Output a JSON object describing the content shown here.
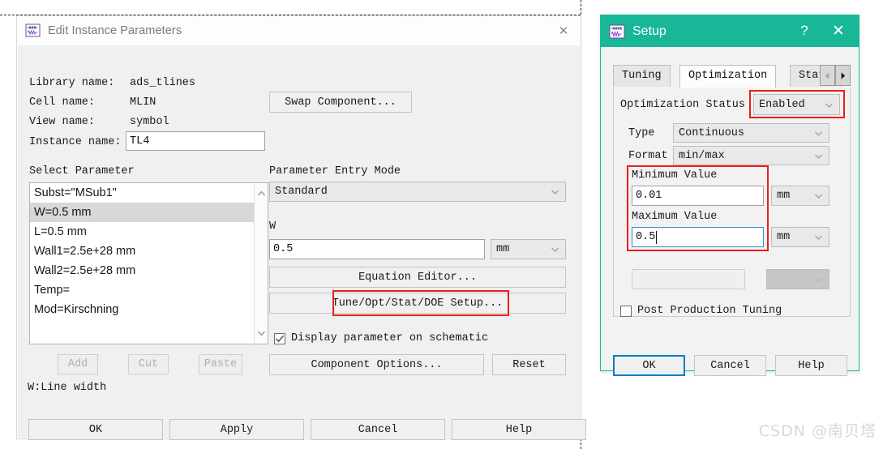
{
  "edit_dialog": {
    "title": "Edit Instance Parameters",
    "close_glyph": "✕",
    "fields": {
      "library_label": "Library name:",
      "library_value": "ads_tlines",
      "cell_label": "Cell name:",
      "cell_value": "MLIN",
      "view_label": "View name:",
      "view_value": "symbol",
      "instance_label": "Instance name:",
      "instance_value": "TL4"
    },
    "swap_button": "Swap Component...",
    "select_parameter_label": "Select Parameter",
    "parameters": [
      {
        "text": "Subst=\"MSub1\"",
        "selected": false
      },
      {
        "text": "W=0.5 mm",
        "selected": true
      },
      {
        "text": "L=0.5 mm",
        "selected": false
      },
      {
        "text": "Wall1=2.5e+28 mm",
        "selected": false
      },
      {
        "text": "Wall2=2.5e+28 mm",
        "selected": false
      },
      {
        "text": "Temp=",
        "selected": false
      },
      {
        "text": "Mod=Kirschning",
        "selected": false
      }
    ],
    "list_buttons": [
      {
        "label": "Add",
        "enabled": false
      },
      {
        "label": "Cut",
        "enabled": false
      },
      {
        "label": "Paste",
        "enabled": false
      }
    ],
    "hint": "W:Line width",
    "entry_mode_label": "Parameter Entry Mode",
    "entry_mode_value": "Standard",
    "param_name": "W",
    "param_value": "0.5",
    "param_unit": "mm",
    "equation_editor_button": "Equation Editor...",
    "tune_setup_button": "Tune/Opt/Stat/DOE Setup...",
    "display_checkbox_label": "Display parameter on schematic",
    "display_checkbox_checked": true,
    "component_options_button": "Component Options...",
    "reset_button": "Reset",
    "footer_buttons": [
      "OK",
      "Apply",
      "Cancel",
      "Help"
    ]
  },
  "setup_dialog": {
    "title": "Setup",
    "help_glyph": "?",
    "close_glyph": "✕",
    "tabs": [
      {
        "label": "Tuning",
        "active": false
      },
      {
        "label": "Optimization",
        "active": true
      },
      {
        "label": "Stati",
        "active": false
      }
    ],
    "tab_scroll_left": "◀",
    "tab_scroll_right": "▶",
    "status_label": "Optimization Status",
    "status_value": "Enabled",
    "type_label": "Type",
    "type_value": "Continuous",
    "format_label": "Format",
    "format_value": "min/max",
    "minimum_label": "Minimum Value",
    "minimum_value": "0.01",
    "minimum_unit": "mm",
    "maximum_label": "Maximum Value",
    "maximum_value": "0.5",
    "maximum_unit": "mm",
    "extra_value": "",
    "extra_unit": "",
    "post_production_label": "Post Production Tuning",
    "post_production_checked": false,
    "footer_buttons": [
      "OK",
      "Cancel",
      "Help"
    ]
  },
  "watermark": "CSDN @南贝塔",
  "colors": {
    "setup_title_bar": "#17b798",
    "highlight_red": "#ee1c1c",
    "focus_blue": "#2a8fd0"
  }
}
